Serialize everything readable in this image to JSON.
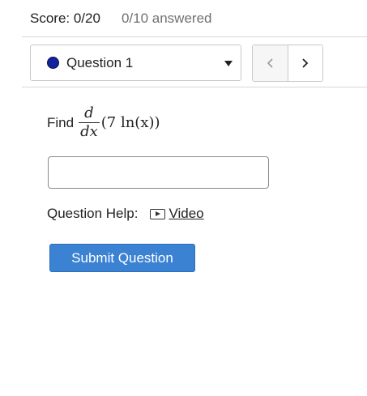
{
  "score": {
    "label": "Score: 0/20",
    "answered": "0/10 answered"
  },
  "question_selector": {
    "selected": "Question 1",
    "status_color": "#13239e",
    "icon": "chevron-down-icon"
  },
  "nav": {
    "prev_icon": "chevron-left-icon",
    "next_icon": "chevron-right-icon"
  },
  "question": {
    "prompt": "Find",
    "derivative_numerator": "d",
    "derivative_denominator": "dx",
    "expression": "(7 ln(x))"
  },
  "answer": {
    "value": "",
    "placeholder": ""
  },
  "help": {
    "label": "Question Help:",
    "video_label": "Video",
    "video_icon": "video-play-icon"
  },
  "submit": {
    "label": "Submit Question",
    "color": "#3b82d2"
  }
}
